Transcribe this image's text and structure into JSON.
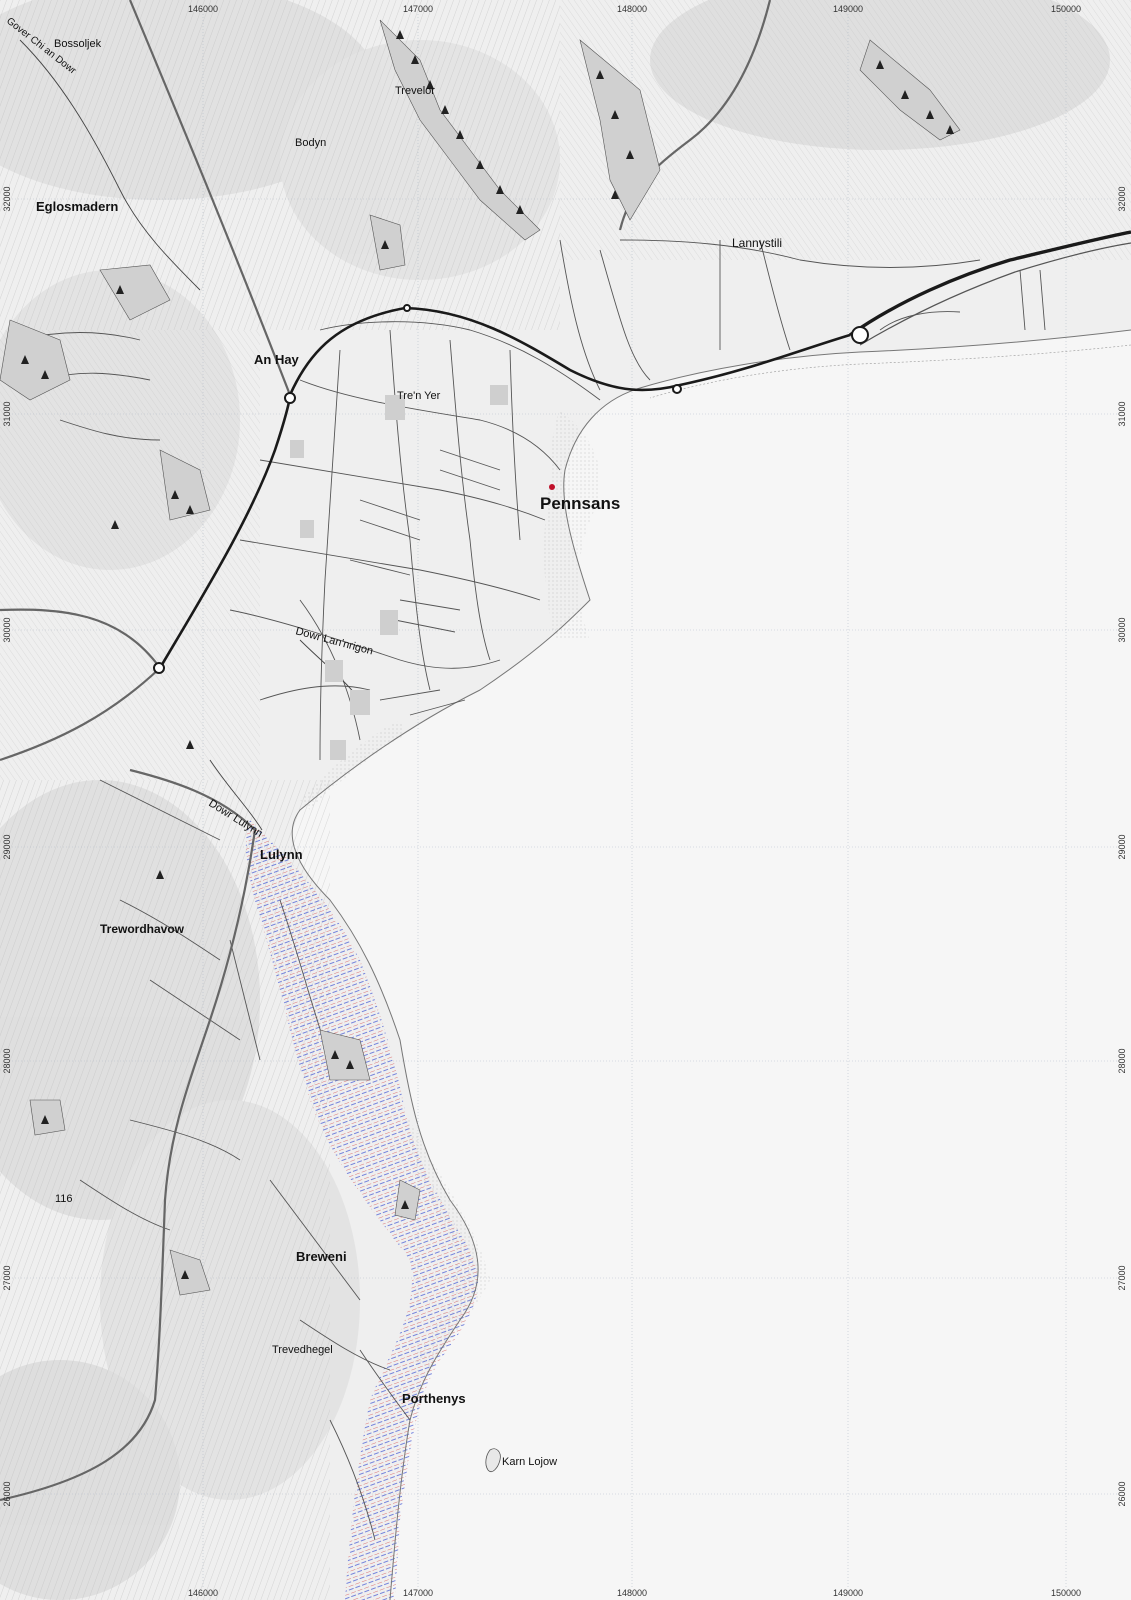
{
  "map": {
    "grid_x": [
      "146000",
      "147000",
      "148000",
      "149000",
      "150000"
    ],
    "grid_y": [
      "32000",
      "31000",
      "30000",
      "29000",
      "28000",
      "27000",
      "26000"
    ],
    "places": [
      {
        "id": "gover",
        "label": "Gover Chi an Dowr",
        "kind": "stream"
      },
      {
        "id": "bossoljek",
        "label": "Bossoljek",
        "kind": "hamlet"
      },
      {
        "id": "trevelor",
        "label": "Trevelor",
        "kind": "hamlet"
      },
      {
        "id": "bodyn",
        "label": "Bodyn",
        "kind": "hamlet"
      },
      {
        "id": "eglosmadern",
        "label": "Eglosmadern",
        "kind": "village"
      },
      {
        "id": "lannystili",
        "label": "Lannystili",
        "kind": "village"
      },
      {
        "id": "anhay",
        "label": "An Hay",
        "kind": "village"
      },
      {
        "id": "trenyer",
        "label": "Tre'n Yer",
        "kind": "suburb"
      },
      {
        "id": "pennsans",
        "label": "Pennsans",
        "kind": "town"
      },
      {
        "id": "dowrlanmorn",
        "label": "Dowr Lan'nrigon",
        "kind": "stream"
      },
      {
        "id": "dowrlulynn",
        "label": "Dowr Lulynn",
        "kind": "stream"
      },
      {
        "id": "lulynn",
        "label": "Lulynn",
        "kind": "village"
      },
      {
        "id": "trewordhavow",
        "label": "Trewordhavow",
        "kind": "village"
      },
      {
        "id": "spot116",
        "label": "116",
        "kind": "spot-height"
      },
      {
        "id": "breweni",
        "label": "Breweni",
        "kind": "village"
      },
      {
        "id": "trevedhegel",
        "label": "Trevedhegel",
        "kind": "hamlet"
      },
      {
        "id": "porthenys",
        "label": "Porthenys",
        "kind": "village"
      },
      {
        "id": "karnlojow",
        "label": "Karn Lojow",
        "kind": "island"
      }
    ],
    "colors": {
      "land": "#f1f1f1",
      "sea": "#f6f6f6",
      "hill_shade": "#dadada",
      "road_major": "#1a1a1a",
      "road_minor": "#555555",
      "town_marker": "#c0102a",
      "cliff_red": "#d23a3a",
      "cliff_blue": "#3a4fd2"
    }
  }
}
